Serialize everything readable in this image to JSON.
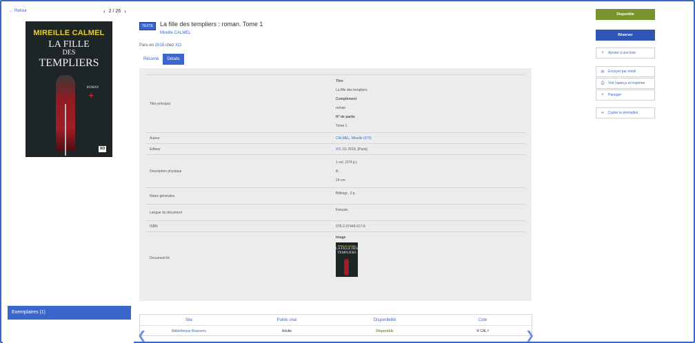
{
  "nav": {
    "back_label": "Retour",
    "back_arrow": "←",
    "prev_arrow": "‹",
    "next_arrow": "›",
    "position": "2 / 26"
  },
  "cover": {
    "author": "MIREILLE CALMEL",
    "title_line1": "LA FILLE",
    "title_line2": "DES",
    "title_line3": "TEMPLIERS",
    "genre": "ROMAN",
    "cross": "+",
    "publisher_mark": "XO"
  },
  "record": {
    "type_badge": "TEXTE",
    "title": "La fille des templiers : roman. Tome 1",
    "author": "Mireille CALMEL",
    "published_prefix": "Paru en",
    "published_year": "2018",
    "published_mid": "chez",
    "publisher": "XO"
  },
  "tabs": [
    {
      "label": "Résumé"
    },
    {
      "label": "Détails"
    }
  ],
  "details": {
    "titre_principal": {
      "label": "Titre principal",
      "h1": "Titre",
      "v1": "La fille des templiers",
      "h2": "Complément",
      "v2": "roman",
      "h3": "N° de partie",
      "v3": "Tome 1"
    },
    "auteur": {
      "label": "Auteur",
      "value": "CALMEL, Mireille (070)"
    },
    "editeur": {
      "label": "Editeur",
      "link": "XO",
      "rest": ", DL 2018, [Paris]"
    },
    "description": {
      "label": "Description physique",
      "v1": "1 vol. (374 p.)",
      "v2": "ill.",
      "v3": "24 cm"
    },
    "notes": {
      "label": "Notes générales",
      "value": "Bibliogr., 3 p."
    },
    "langue": {
      "label": "Langue du document",
      "value": "français"
    },
    "isbn": {
      "label": "ISBN",
      "value": "978-2-37448-017-6"
    },
    "document_lie": {
      "label": "Document lié",
      "heading": "Image",
      "thumb_author": "MIREILLE CALMEL",
      "thumb_title": "LA FILLE DES TEMPLIERS"
    }
  },
  "exemplaires": {
    "label": "Exemplaires (1)"
  },
  "copies_table": {
    "headers": [
      "Site",
      "Public visé",
      "Disponibilité",
      "Cote"
    ],
    "row": {
      "site": "Bibliothèque Brassens",
      "public": "Adulte",
      "dispo": "Disponible",
      "cote": "R CAL f"
    },
    "left_arrow": "❮",
    "right_arrow": "❯"
  },
  "actions": {
    "availability": "Disponible",
    "reserve": "Réserver",
    "add_list": "Ajouter à une liste",
    "add_list_icon": "+",
    "email": "Envoyer par email",
    "email_icon": "✉",
    "print": "Voir l'aperçu et imprimer",
    "print_icon": "⎙",
    "share": "Partager",
    "share_icon": "<",
    "permalink": "Copier le permalien",
    "permalink_icon": "∞"
  },
  "colors": {
    "accent": "#3a66cc",
    "available": "#78952d",
    "reserve": "#2f55b5"
  }
}
